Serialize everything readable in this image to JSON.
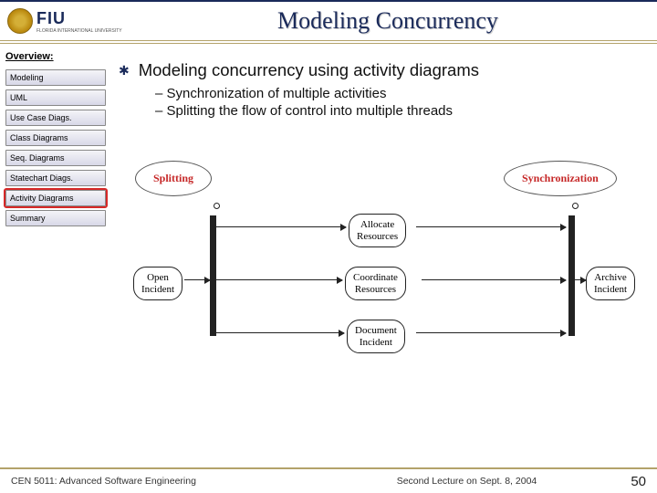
{
  "header": {
    "logo_main": "FIU",
    "logo_sub": "FLORIDA INTERNATIONAL UNIVERSITY",
    "title": "Modeling Concurrency"
  },
  "sidebar": {
    "heading": "Overview:",
    "items": [
      {
        "label": "Modeling",
        "active": false
      },
      {
        "label": "UML",
        "active": false
      },
      {
        "label": "Use Case Diags.",
        "active": false
      },
      {
        "label": "Class Diagrams",
        "active": false
      },
      {
        "label": "Seq. Diagrams",
        "active": false
      },
      {
        "label": "Statechart Diags.",
        "active": false
      },
      {
        "label": "Activity Diagrams",
        "active": true
      },
      {
        "label": "Summary",
        "active": false
      }
    ]
  },
  "content": {
    "bullet": "Modeling concurrency using activity diagrams",
    "sub_bullets": [
      "Synchronization of multiple activities",
      "Splitting the flow of control into multiple threads"
    ],
    "labels": {
      "splitting": "Splitting",
      "synchronization": "Synchronization"
    },
    "activities": {
      "open": "Open\nIncident",
      "allocate": "Allocate\nResources",
      "coordinate": "Coordinate\nResources",
      "document": "Document\nIncident",
      "archive": "Archive\nIncident"
    }
  },
  "footer": {
    "course": "CEN 5011: Advanced Software Engineering",
    "lecture": "Second Lecture on Sept. 8, 2004",
    "page": "50"
  }
}
